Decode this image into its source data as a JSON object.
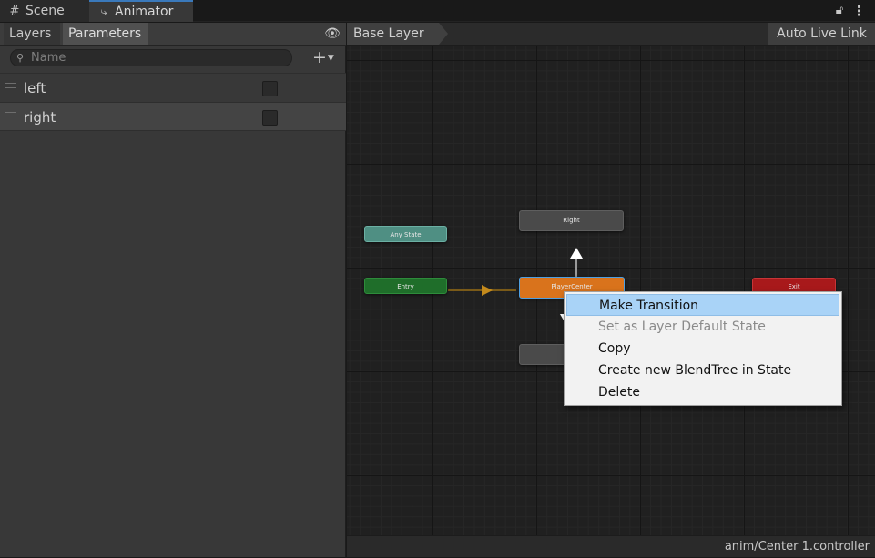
{
  "tabs": [
    {
      "label": "Scene",
      "icon": "grid-icon"
    },
    {
      "label": "Animator",
      "icon": "animator-icon"
    }
  ],
  "window_icons": {
    "lock": "lock-icon",
    "menu": "kebab-menu-icon"
  },
  "left_panel": {
    "subtabs": [
      "Layers",
      "Parameters"
    ],
    "visibility_icon": "eye-icon",
    "search": {
      "placeholder": "Name",
      "value": ""
    },
    "add_label": "+",
    "parameters": [
      {
        "name": "left",
        "type": "bool",
        "checked": false
      },
      {
        "name": "right",
        "type": "bool",
        "checked": false
      }
    ]
  },
  "graph": {
    "breadcrumb": "Base Layer",
    "auto_live_link": "Auto Live Link",
    "nodes": {
      "any_state": "Any State",
      "entry": "Entry",
      "right": "Right",
      "center": "PlayerCenter",
      "exit": "Exit"
    },
    "colors": {
      "any_state": "#4f8f83",
      "entry": "#1f6e2a",
      "default_state": "#d9731c",
      "exit": "#a8191b",
      "state": "#4a4a4a"
    }
  },
  "context_menu": {
    "items": [
      {
        "label": "Make Transition",
        "enabled": true,
        "highlighted": true
      },
      {
        "label": "Set as Layer Default State",
        "enabled": false
      },
      {
        "label": "Copy",
        "enabled": true
      },
      {
        "label": "Create new BlendTree in State",
        "enabled": true
      },
      {
        "label": "Delete",
        "enabled": true
      }
    ]
  },
  "status": {
    "path": "anim/Center 1.controller"
  }
}
